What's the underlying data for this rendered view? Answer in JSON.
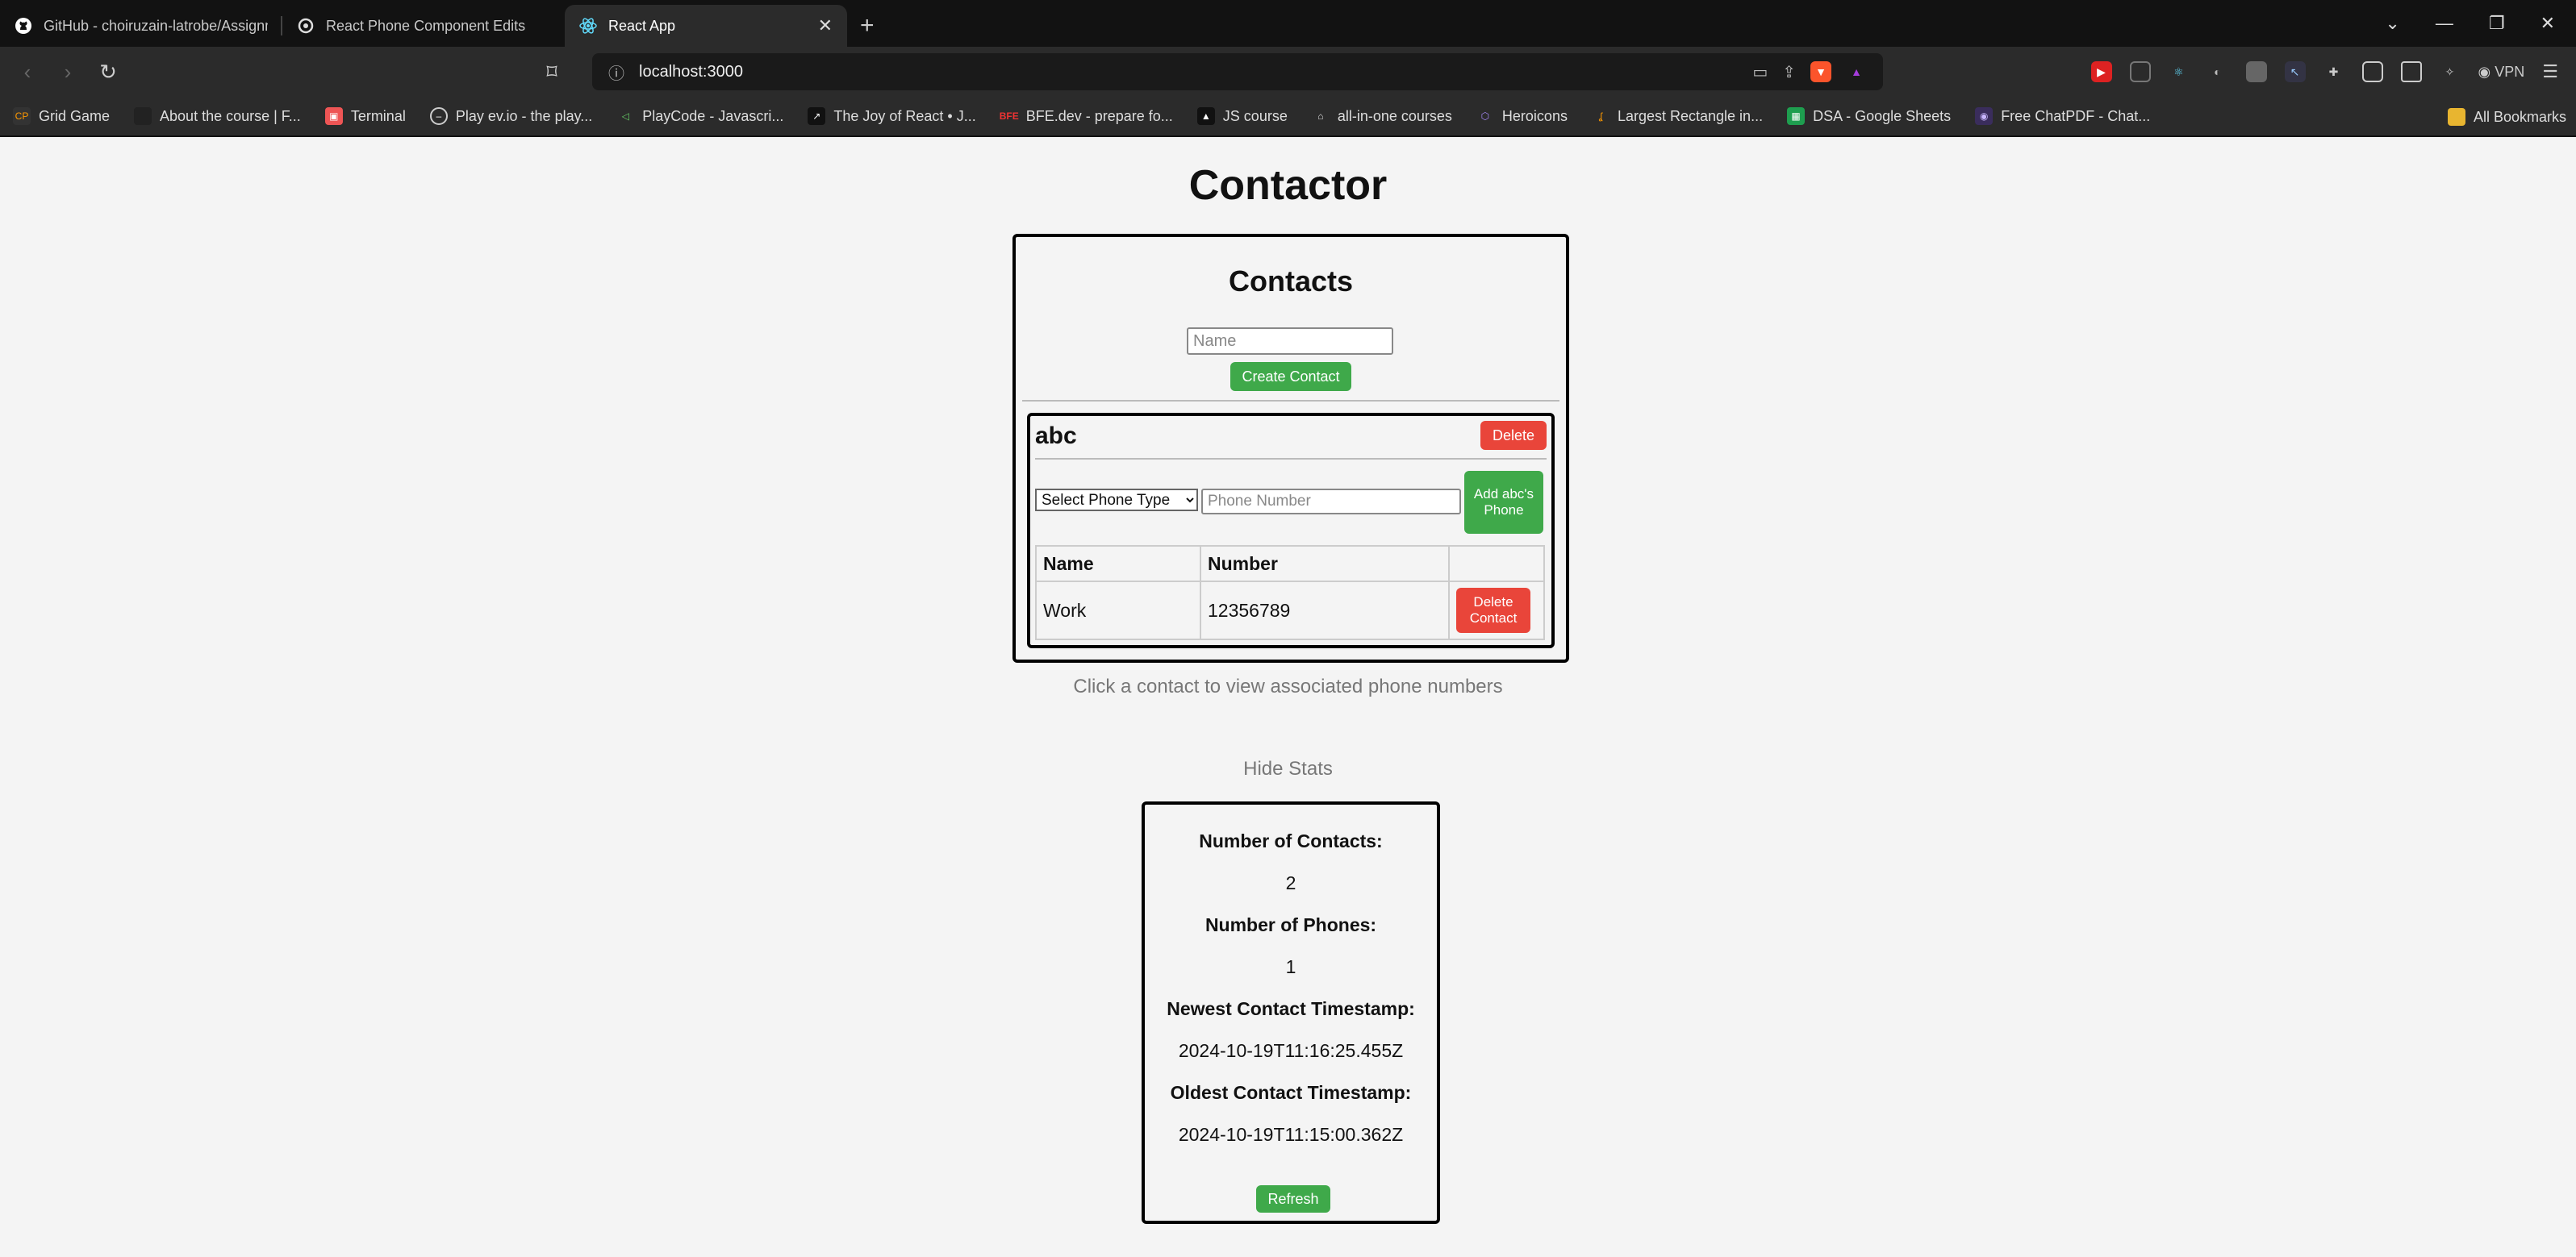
{
  "browser": {
    "tabs": [
      {
        "title": "GitHub - choiruzain-latrobe/Assignm",
        "icon": "github-icon"
      },
      {
        "title": "React Phone Component Edits",
        "icon": "openai-icon"
      },
      {
        "title": "React App",
        "icon": "react-icon"
      }
    ],
    "new_tab": "+",
    "url": "localhost:3000",
    "vpn_label": "VPN",
    "bookmarks": [
      {
        "label": "Grid Game"
      },
      {
        "label": "About the course | F..."
      },
      {
        "label": "Terminal"
      },
      {
        "label": "Play ev.io - the play..."
      },
      {
        "label": "PlayCode - Javascri..."
      },
      {
        "label": "The Joy of React • J..."
      },
      {
        "label": "BFE.dev - prepare fo..."
      },
      {
        "label": "JS course"
      },
      {
        "label": "all-in-one courses"
      },
      {
        "label": "Heroicons"
      },
      {
        "label": "Largest Rectangle in..."
      },
      {
        "label": "DSA - Google Sheets"
      },
      {
        "label": "Free ChatPDF - Chat..."
      }
    ],
    "all_bookmarks": "All Bookmarks"
  },
  "app": {
    "title": "Contactor",
    "contacts_heading": "Contacts",
    "name_placeholder": "Name",
    "create_label": "Create Contact",
    "contact": {
      "name": "abc",
      "delete_label": "Delete",
      "phone_type_selected": "Select Phone Type",
      "phone_placeholder": "Phone Number",
      "add_phone_label": "Add abc's Phone",
      "table_headers": [
        "Name",
        "Number",
        ""
      ],
      "phones": [
        {
          "name": "Work",
          "number": "12356789",
          "delete_label": "Delete Contact"
        }
      ]
    },
    "hint": "Click a contact to view associated phone numbers",
    "hide_stats": "Hide Stats",
    "stats": {
      "contacts_label": "Number of Contacts:",
      "contacts_value": "2",
      "phones_label": "Number of Phones:",
      "phones_value": "1",
      "newest_label": "Newest Contact Timestamp:",
      "newest_value": "2024-10-19T11:16:25.455Z",
      "oldest_label": "Oldest Contact Timestamp:",
      "oldest_value": "2024-10-19T11:15:00.362Z",
      "refresh_label": "Refresh"
    }
  }
}
